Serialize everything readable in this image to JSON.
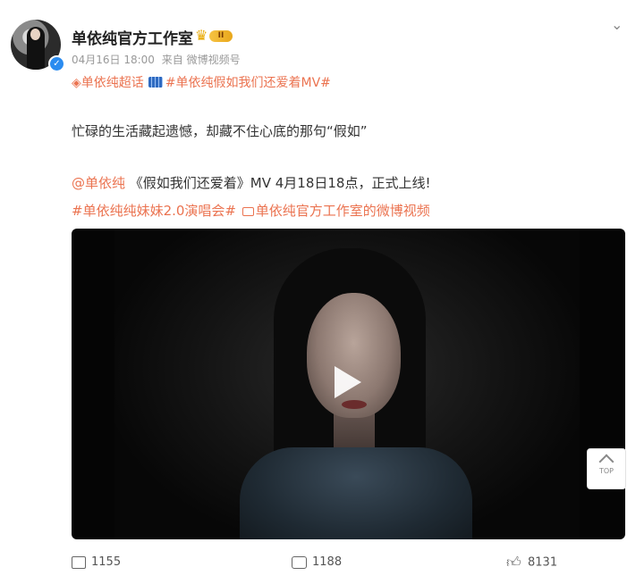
{
  "post": {
    "username": "单依纯官方工作室",
    "vip_level": "II",
    "timestamp": "04月16日 18:00",
    "source": "来自 微博视频号",
    "topics": {
      "super_topic": "单依纯超话",
      "hashtag": "#单依纯假如我们还爱着MV#"
    },
    "para1": "忙碌的生活藏起遗憾，却藏不住心底的那句“假如”",
    "para2": {
      "mention": "@单依纯",
      "text": " 《假如我们还爱着》MV 4月18日18点，正式上线!"
    },
    "para3": {
      "hashtag": "#单依纯纯妹妹2.0演唱会#",
      "video_link": "单依纯官方工作室的微博视频"
    }
  },
  "top_button": {
    "label": "TOP"
  },
  "actions": {
    "share_count": "1155",
    "comment_count": "1188",
    "like_count": "8131"
  },
  "icons": [
    "verified-icon",
    "vip-crown-icon",
    "chevron-down-icon",
    "super-topic-icon",
    "film-icon",
    "video-link-icon",
    "play-icon",
    "share-icon",
    "comment-icon",
    "like-icon"
  ],
  "colors": {
    "link": "#eb7350",
    "verified": "#2b8cf0",
    "vip": "#e9a71b"
  }
}
